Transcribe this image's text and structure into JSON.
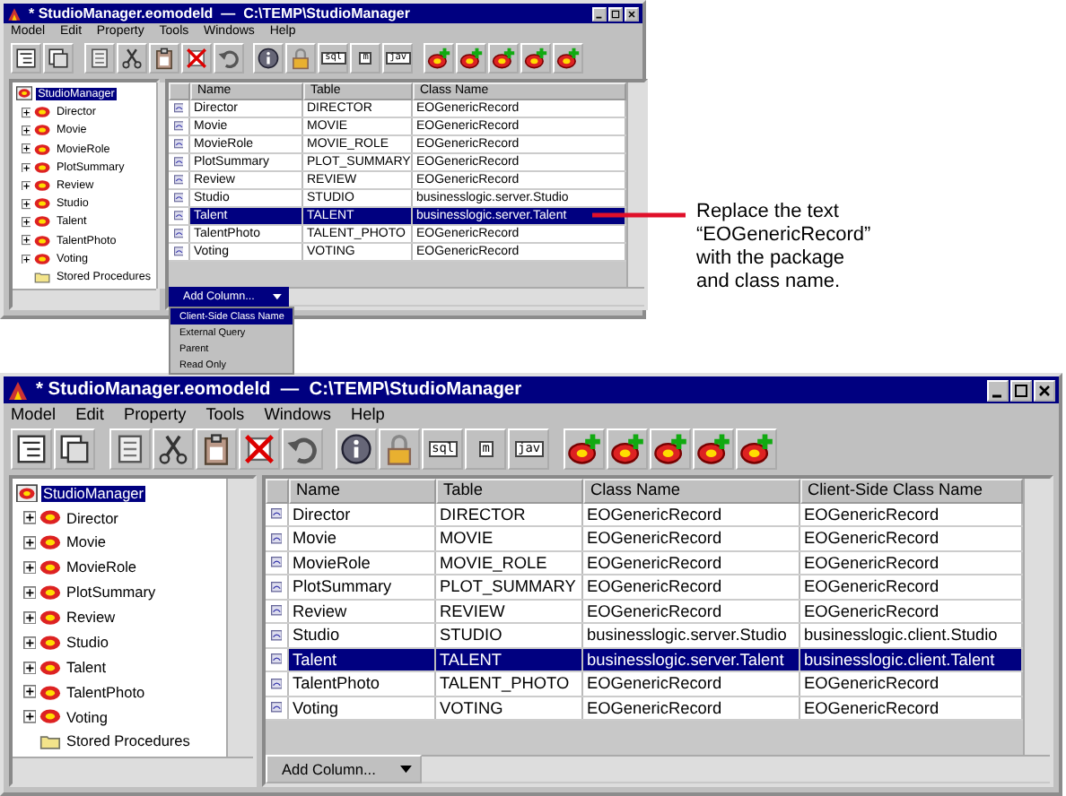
{
  "windows": [
    {
      "title": "* StudioManager.eomodeld  —  C:\\TEMP\\StudioManager",
      "menu": [
        "Model",
        "Edit",
        "Property",
        "Tools",
        "Windows",
        "Help"
      ],
      "toolbar": [
        [
          {
            "kind": "outline"
          },
          {
            "kind": "pages"
          }
        ],
        [
          {
            "kind": "form"
          },
          {
            "kind": "cut"
          },
          {
            "kind": "paste"
          },
          {
            "kind": "delete"
          },
          {
            "kind": "undo"
          }
        ],
        [
          {
            "kind": "info"
          },
          {
            "kind": "lock"
          },
          {
            "kind": "text",
            "label": "sql"
          },
          {
            "kind": "text",
            "label": "m"
          },
          {
            "kind": "text",
            "label": "jav"
          }
        ],
        [
          {
            "kind": "add"
          },
          {
            "kind": "add"
          },
          {
            "kind": "add"
          },
          {
            "kind": "add"
          },
          {
            "kind": "add"
          }
        ]
      ],
      "tree": {
        "label": "StudioManager",
        "selected": true,
        "children": [
          {
            "label": "Director",
            "kind": "entity",
            "expanded": false
          },
          {
            "label": "Movie",
            "kind": "entity",
            "expanded": false
          },
          {
            "label": "MovieRole",
            "kind": "entity",
            "expanded": false
          },
          {
            "label": "PlotSummary",
            "kind": "entity",
            "expanded": false
          },
          {
            "label": "Review",
            "kind": "entity",
            "expanded": false
          },
          {
            "label": "Studio",
            "kind": "entity",
            "expanded": false
          },
          {
            "label": "Talent",
            "kind": "entity",
            "expanded": false
          },
          {
            "label": "TalentPhoto",
            "kind": "entity",
            "expanded": false
          },
          {
            "label": "Voting",
            "kind": "entity",
            "expanded": false
          },
          {
            "label": "Stored Procedures",
            "kind": "folder"
          }
        ]
      },
      "columns": [
        "Name",
        "Table",
        "Class Name"
      ],
      "rows": [
        {
          "cells": [
            "Director",
            "DIRECTOR",
            "EOGenericRecord"
          ],
          "selected": false
        },
        {
          "cells": [
            "Movie",
            "MOVIE",
            "EOGenericRecord"
          ],
          "selected": false
        },
        {
          "cells": [
            "MovieRole",
            "MOVIE_ROLE",
            "EOGenericRecord"
          ],
          "selected": false
        },
        {
          "cells": [
            "PlotSummary",
            "PLOT_SUMMARY",
            "EOGenericRecord"
          ],
          "selected": false
        },
        {
          "cells": [
            "Review",
            "REVIEW",
            "EOGenericRecord"
          ],
          "selected": false
        },
        {
          "cells": [
            "Studio",
            "STUDIO",
            "businesslogic.server.Studio"
          ],
          "selected": false
        },
        {
          "cells": [
            "Talent",
            "TALENT",
            "businesslogic.server.Talent"
          ],
          "selected": true
        },
        {
          "cells": [
            "TalentPhoto",
            "TALENT_PHOTO",
            "EOGenericRecord"
          ],
          "selected": false
        },
        {
          "cells": [
            "Voting",
            "VOTING",
            "EOGenericRecord"
          ],
          "selected": false
        }
      ],
      "add_column": "Add Column...",
      "dropdown": [
        {
          "label": "Client-Side Class Name",
          "selected": true
        },
        {
          "label": "External Query",
          "selected": false
        },
        {
          "label": "Parent",
          "selected": false
        },
        {
          "label": "Read Only",
          "selected": false
        }
      ]
    },
    {
      "title": "* StudioManager.eomodeld  —  C:\\TEMP\\StudioManager",
      "menu": [
        "Model",
        "Edit",
        "Property",
        "Tools",
        "Windows",
        "Help"
      ],
      "toolbar": [
        [
          {
            "kind": "outline"
          },
          {
            "kind": "pages"
          }
        ],
        [
          {
            "kind": "form"
          },
          {
            "kind": "cut"
          },
          {
            "kind": "paste"
          },
          {
            "kind": "delete"
          },
          {
            "kind": "undo"
          }
        ],
        [
          {
            "kind": "info"
          },
          {
            "kind": "lock"
          },
          {
            "kind": "text",
            "label": "sql"
          },
          {
            "kind": "text",
            "label": "m"
          },
          {
            "kind": "text",
            "label": "jav"
          }
        ],
        [
          {
            "kind": "add"
          },
          {
            "kind": "add"
          },
          {
            "kind": "add"
          },
          {
            "kind": "add"
          },
          {
            "kind": "add"
          }
        ]
      ],
      "tree": {
        "label": "StudioManager",
        "selected": true,
        "children": [
          {
            "label": "Director",
            "kind": "entity",
            "expanded": false
          },
          {
            "label": "Movie",
            "kind": "entity",
            "expanded": false
          },
          {
            "label": "MovieRole",
            "kind": "entity",
            "expanded": false
          },
          {
            "label": "PlotSummary",
            "kind": "entity",
            "expanded": false
          },
          {
            "label": "Review",
            "kind": "entity",
            "expanded": false
          },
          {
            "label": "Studio",
            "kind": "entity",
            "expanded": false
          },
          {
            "label": "Talent",
            "kind": "entity",
            "expanded": false
          },
          {
            "label": "TalentPhoto",
            "kind": "entity",
            "expanded": false
          },
          {
            "label": "Voting",
            "kind": "entity",
            "expanded": false
          },
          {
            "label": "Stored Procedures",
            "kind": "folder"
          }
        ]
      },
      "columns": [
        "Name",
        "Table",
        "Class Name",
        "Client-Side Class Name"
      ],
      "rows": [
        {
          "cells": [
            "Director",
            "DIRECTOR",
            "EOGenericRecord",
            "EOGenericRecord"
          ],
          "selected": false
        },
        {
          "cells": [
            "Movie",
            "MOVIE",
            "EOGenericRecord",
            "EOGenericRecord"
          ],
          "selected": false
        },
        {
          "cells": [
            "MovieRole",
            "MOVIE_ROLE",
            "EOGenericRecord",
            "EOGenericRecord"
          ],
          "selected": false
        },
        {
          "cells": [
            "PlotSummary",
            "PLOT_SUMMARY",
            "EOGenericRecord",
            "EOGenericRecord"
          ],
          "selected": false
        },
        {
          "cells": [
            "Review",
            "REVIEW",
            "EOGenericRecord",
            "EOGenericRecord"
          ],
          "selected": false
        },
        {
          "cells": [
            "Studio",
            "STUDIO",
            "businesslogic.server.Studio",
            "businesslogic.client.Studio"
          ],
          "selected": false
        },
        {
          "cells": [
            "Talent",
            "TALENT",
            "businesslogic.server.Talent",
            "businesslogic.client.Talent"
          ],
          "selected": true
        },
        {
          "cells": [
            "TalentPhoto",
            "TALENT_PHOTO",
            "EOGenericRecord",
            "EOGenericRecord"
          ],
          "selected": false
        },
        {
          "cells": [
            "Voting",
            "VOTING",
            "EOGenericRecord",
            "EOGenericRecord"
          ],
          "selected": false
        }
      ],
      "add_column": "Add Column..."
    }
  ],
  "callout": {
    "text": "Replace the text “EOGenericRecord” with the package and class name."
  }
}
